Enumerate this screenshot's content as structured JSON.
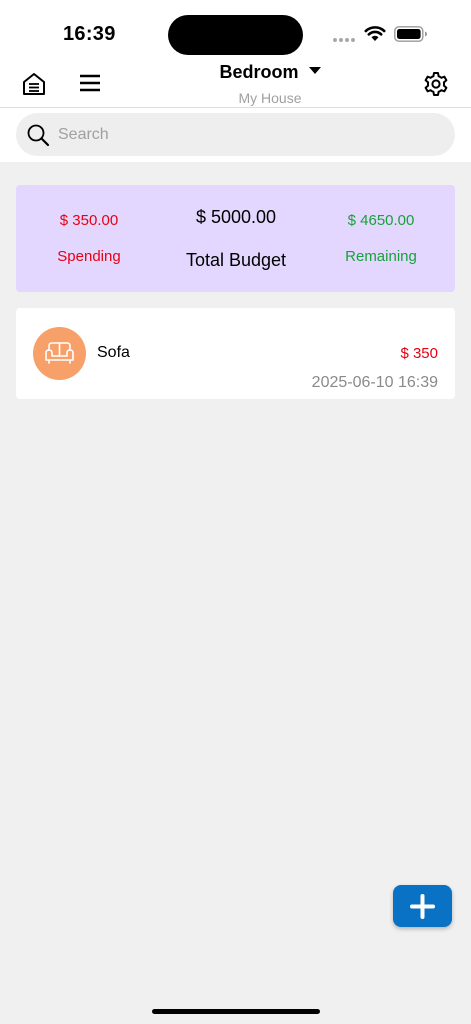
{
  "status_bar": {
    "time": "16:39"
  },
  "nav": {
    "title": "Bedroom",
    "subtitle": "My House"
  },
  "search": {
    "placeholder": "Search",
    "value": ""
  },
  "budget": {
    "spending_amount": "$ 350.00",
    "spending_label": "Spending",
    "total_amount": "$ 5000.00",
    "total_label": "Total Budget",
    "remaining_amount": "$ 4650.00",
    "remaining_label": "Remaining"
  },
  "expenses": [
    {
      "name": "Sofa",
      "amount": "$ 350",
      "datetime": "2025-06-10 16:39",
      "icon": "sofa-icon"
    }
  ],
  "colors": {
    "spending": "#e60012",
    "remaining": "#18a03a",
    "card_bg": "#e4d7ff",
    "avatar_bg": "#f8a06a",
    "fab": "#0a72c4"
  },
  "icons": {
    "left_1": "house-icon",
    "left_2": "menu-icon",
    "title_caret": "caret-down-icon",
    "right": "gear-icon",
    "search": "search-icon",
    "fab": "plus-icon"
  }
}
